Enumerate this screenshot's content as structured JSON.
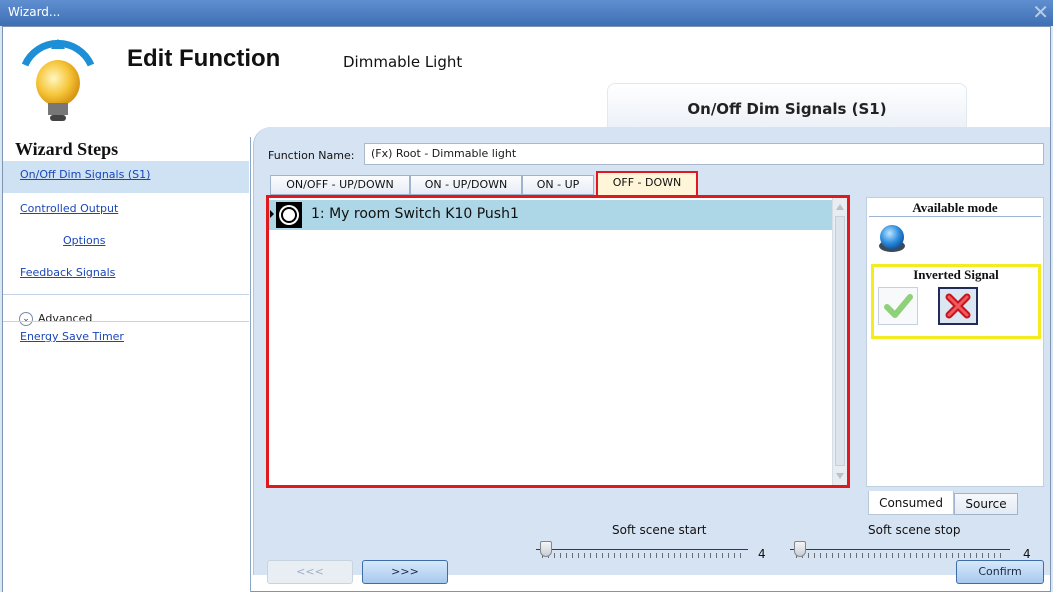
{
  "window": {
    "title": "Wizard...",
    "close_icon": "close-icon"
  },
  "header": {
    "title": "Edit Function",
    "subtitle": "Dimmable Light",
    "step_title": "On/Off Dim Signals (S1)",
    "icon": "light-bulb-icon"
  },
  "sidebar": {
    "title": "Wizard Steps",
    "items": [
      {
        "label": "On/Off Dim Signals (S1)",
        "selected": true
      },
      {
        "label": "Controlled Output"
      },
      {
        "label": "Options"
      },
      {
        "label": "Feedback Signals"
      }
    ],
    "advanced_label": "Advanced",
    "advanced_items": [
      {
        "label": "Energy Save Timer"
      }
    ]
  },
  "form": {
    "function_name_label": "Function Name:",
    "function_name_value": "(Fx) Root - Dimmable light"
  },
  "tabs": [
    {
      "label": "ON/OFF - UP/DOWN"
    },
    {
      "label": "ON - UP/DOWN"
    },
    {
      "label": "ON - UP"
    },
    {
      "label": "OFF - DOWN",
      "active": true
    }
  ],
  "signals": [
    {
      "label": "1: My room Switch K10 Push1",
      "icon": "push-button-icon"
    }
  ],
  "side_panel": {
    "available_mode_title": "Available mode",
    "available_mode_icon": "blue-pushbutton-icon",
    "inverted_signal_title": "Inverted Signal",
    "check_icon": "check-icon",
    "x_icon": "x-icon"
  },
  "bottom_tabs": {
    "consumed": "Consumed",
    "source": "Source"
  },
  "sliders": {
    "start_label": "Soft scene start",
    "start_value": "4",
    "stop_label": "Soft scene stop",
    "stop_value": "4"
  },
  "footer": {
    "prev": "<<<",
    "next": ">>>",
    "confirm": "Confirm"
  },
  "colors": {
    "highlight_red": "#e0191f",
    "highlight_yellow": "#f5ec1f",
    "titlebar": "#4a7cc0",
    "selected_row": "#add6e6"
  }
}
